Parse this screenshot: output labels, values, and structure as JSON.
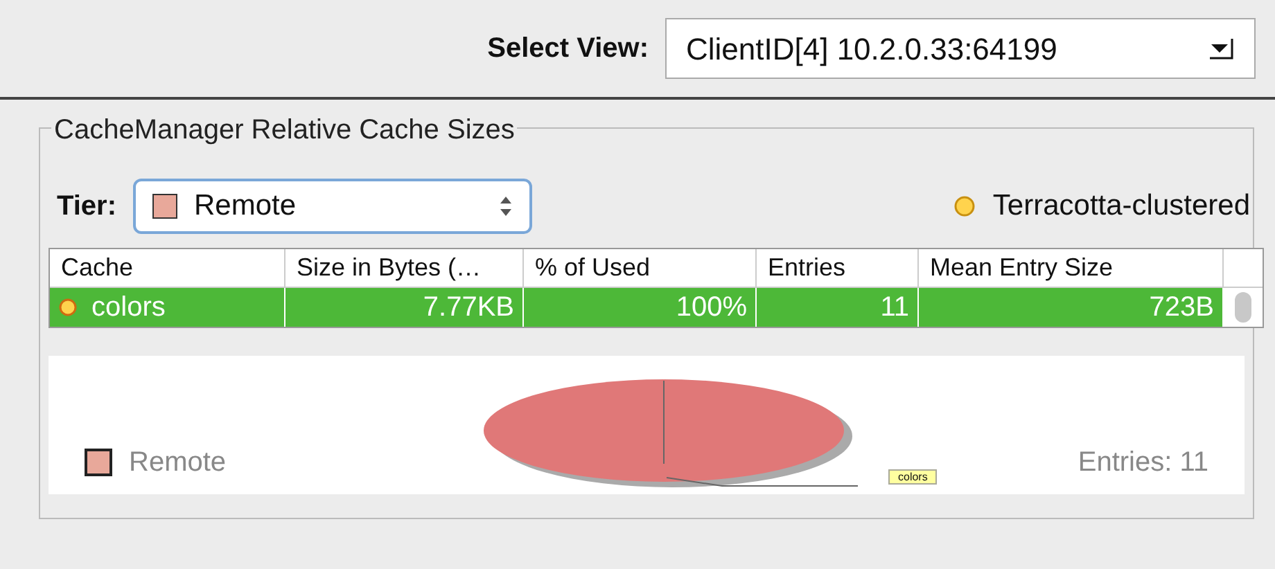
{
  "toolbar": {
    "label": "Select View:",
    "view": "ClientID[4] 10.2.0.33:64199"
  },
  "panel": {
    "title": "CacheManager Relative Cache Sizes",
    "tier": {
      "label": "Tier:",
      "value": "Remote",
      "color": "#e8a89a"
    },
    "mode": {
      "label": "Terracotta-clustered"
    },
    "table": {
      "columns": [
        "Cache",
        "Size in Bytes (…",
        "% of Used",
        "Entries",
        "Mean Entry Size"
      ],
      "rows": [
        {
          "cells": [
            "colors",
            "7.77KB",
            "100%",
            "11",
            "723B"
          ],
          "selected": true
        }
      ]
    },
    "chart": {
      "legend": {
        "label": "Remote",
        "color": "#e8a89a"
      },
      "slice_label": "colors",
      "entries": "Entries: 11"
    }
  }
}
